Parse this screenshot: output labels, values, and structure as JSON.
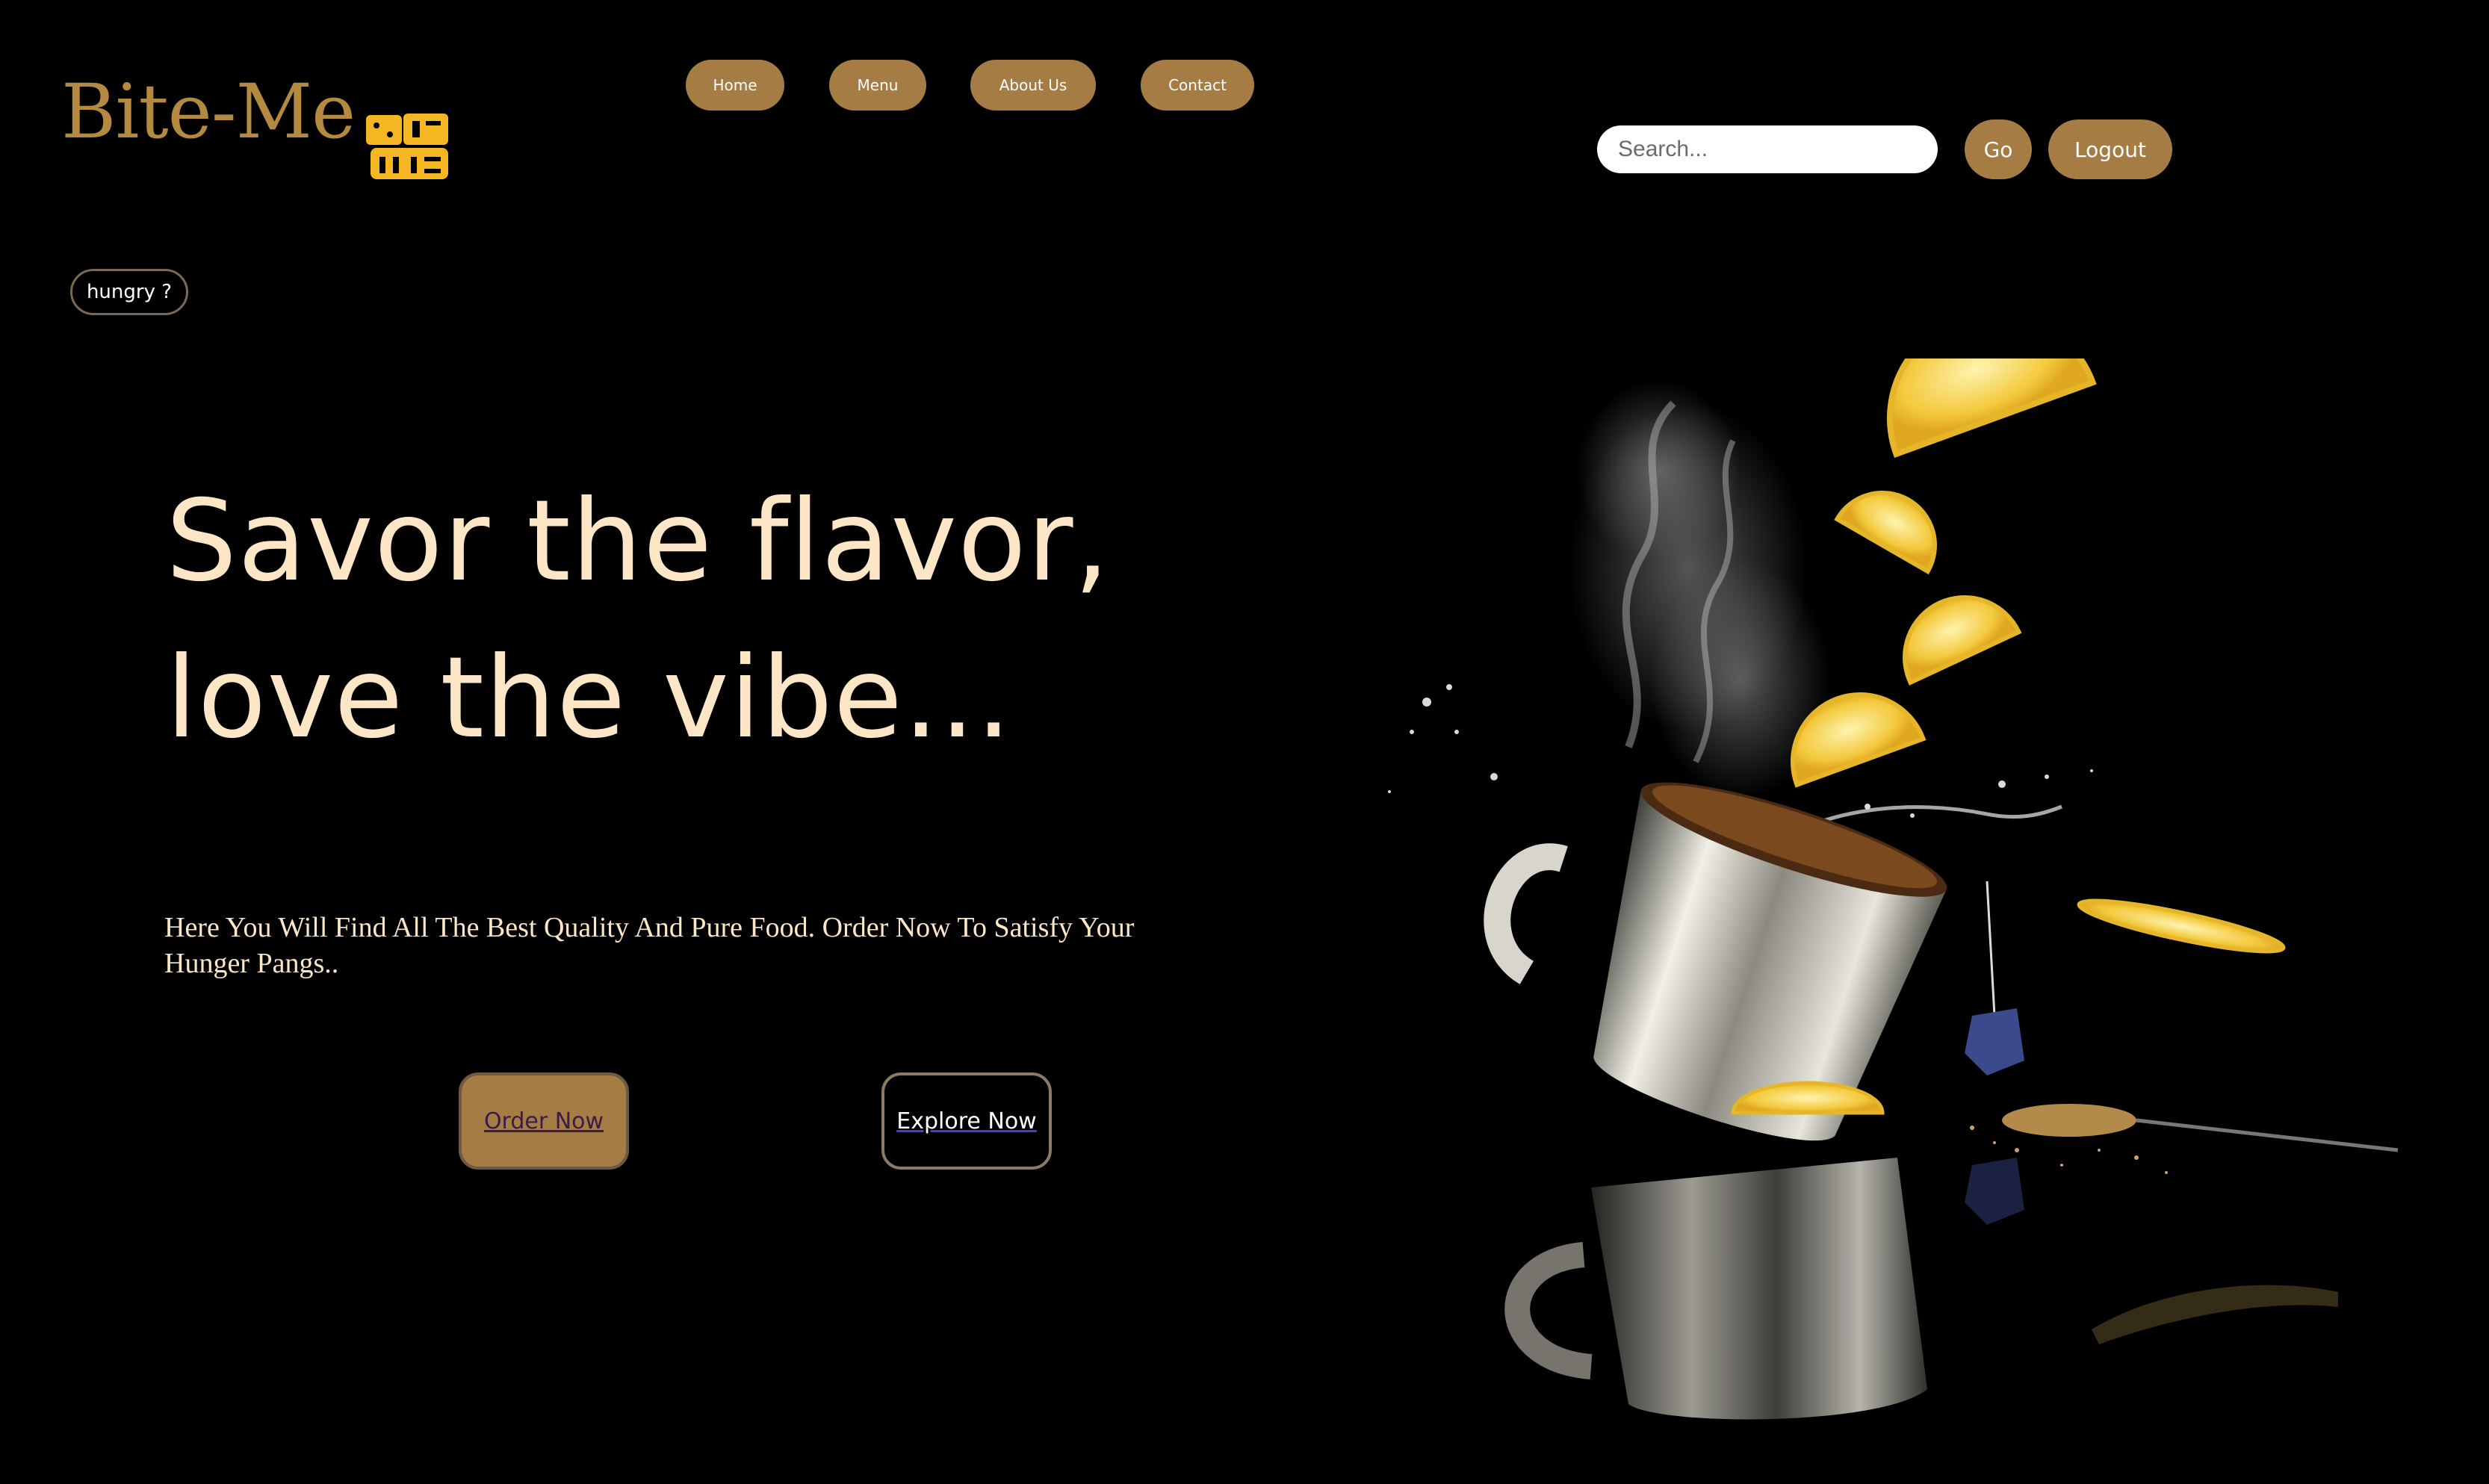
{
  "brand": {
    "name": "Bite-Me",
    "mark_text": "BITE ME",
    "color": "#b38a3f",
    "mark_color": "#f5b623"
  },
  "nav": {
    "items": [
      {
        "label": "Home"
      },
      {
        "label": "Menu"
      },
      {
        "label": "About Us"
      },
      {
        "label": "Contact"
      }
    ],
    "button_color": "#a67c45"
  },
  "search": {
    "placeholder": "Search...",
    "value": "",
    "go_label": "Go"
  },
  "account": {
    "logout_label": "Logout"
  },
  "badge": {
    "label": "hungry ?"
  },
  "hero": {
    "headline_line_1": "Savor the flavor,",
    "headline_line_2": "love the vibe...",
    "subtitle": "Here You Will Find All The Best Quality And Pure Food. Order Now To Satisfy Your Hunger Pangs..",
    "primary_cta": "Order Now",
    "secondary_cta": "Explore Now",
    "text_color": "#fde6c6"
  },
  "hero_image": {
    "icon": "tea-cup-splash-illustration"
  }
}
